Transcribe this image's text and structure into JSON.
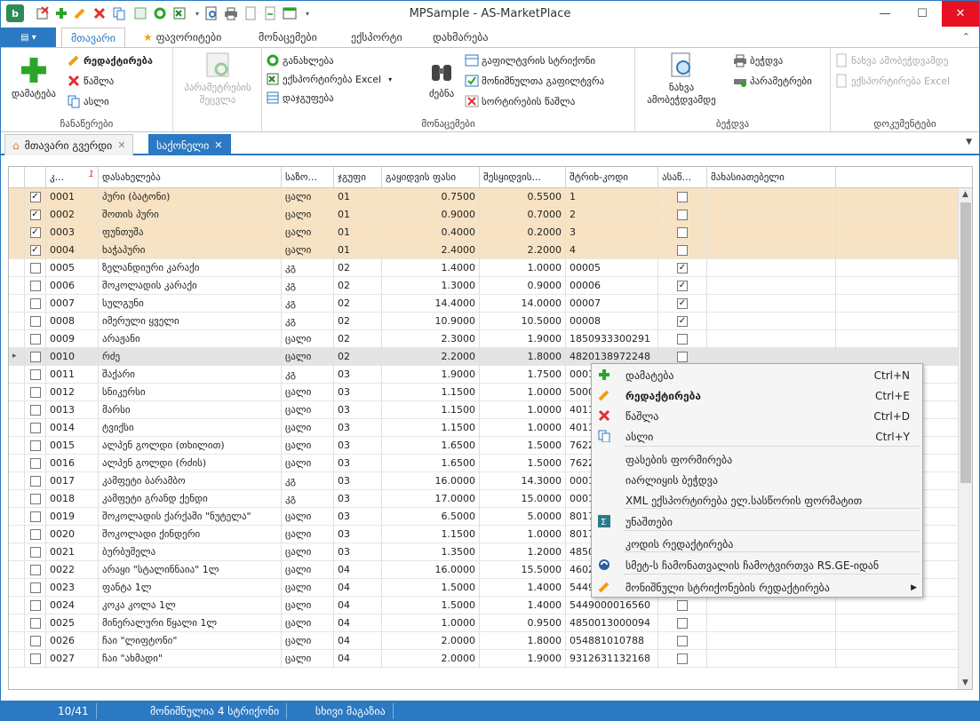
{
  "window": {
    "title": "MPSample - AS-MarketPlace"
  },
  "ribbon_tabs": [
    "მთავარი",
    "ფავორიტები",
    "მონაცემები",
    "ექსპორტი",
    "დახმარება"
  ],
  "ribbon": {
    "group_edit": {
      "caption": "ჩანაწერები",
      "add": "დამატება",
      "edit": "რედაქტირება",
      "delete": "წაშლა",
      "copy": "ასლი"
    },
    "group_params": {
      "label": "პარამეტრების შეცვლა"
    },
    "group_data": {
      "caption": "მონაცემები",
      "refresh": "განახლება",
      "export_excel": "ექსპორტირება Excel",
      "grouping": "დაჯგუფება",
      "search": "ძებნა",
      "filter_row": "გაფილტვრის სტრიქონი",
      "marked_filter": "მონიშნულთა გაფილტვრა",
      "sort_remove": "სორტირების წაშლა"
    },
    "group_print": {
      "caption": "ბეჭდვა",
      "preview": "ნახვა ამობეჭდვამდე",
      "print": "ბეჭდვა",
      "params": "პარამეტრები"
    },
    "group_docs": {
      "caption": "დოკუმენტები",
      "preview": "ნახვა ამობეჭდვამდე",
      "export": "ექსპორტირება Excel"
    }
  },
  "doc_tabs": [
    "მთავარი გვერდი",
    "საქონელი"
  ],
  "grid": {
    "columns": [
      "კ...",
      "დასახელება",
      "საზო...",
      "ჯგუფი",
      "გაყიდვის ფასი",
      "შესყიდვის...",
      "შტრიხ-კოდი",
      "ასაწ...",
      "მახასიათებელი"
    ],
    "rows": [
      {
        "checked": true,
        "code": "0001",
        "name": "პური (ბატონი)",
        "unit": "ცალი",
        "group": "01",
        "sale": "0.7500",
        "buy": "0.5500",
        "barcode": "1",
        "flag": false,
        "state": "sel"
      },
      {
        "checked": true,
        "code": "0002",
        "name": "შოთის პური",
        "unit": "ცალი",
        "group": "01",
        "sale": "0.9000",
        "buy": "0.7000",
        "barcode": "2",
        "flag": false,
        "state": "sel"
      },
      {
        "checked": true,
        "code": "0003",
        "name": "ფუნთუშა",
        "unit": "ცალი",
        "group": "01",
        "sale": "0.4000",
        "buy": "0.2000",
        "barcode": "3",
        "flag": false,
        "state": "sel"
      },
      {
        "checked": true,
        "code": "0004",
        "name": "ხაჭაპური",
        "unit": "ცალი",
        "group": "01",
        "sale": "2.4000",
        "buy": "2.2000",
        "barcode": "4",
        "flag": false,
        "state": "sel"
      },
      {
        "checked": false,
        "code": "0005",
        "name": "ზელანდიური კარაქი",
        "unit": "კგ",
        "group": "02",
        "sale": "1.4000",
        "buy": "1.0000",
        "barcode": "00005",
        "flag": true,
        "state": ""
      },
      {
        "checked": false,
        "code": "0006",
        "name": "შოკოლადის კარაქი",
        "unit": "კგ",
        "group": "02",
        "sale": "1.3000",
        "buy": "0.9000",
        "barcode": "00006",
        "flag": true,
        "state": ""
      },
      {
        "checked": false,
        "code": "0007",
        "name": "სულგუნი",
        "unit": "კგ",
        "group": "02",
        "sale": "14.4000",
        "buy": "14.0000",
        "barcode": "00007",
        "flag": true,
        "state": ""
      },
      {
        "checked": false,
        "code": "0008",
        "name": "იმერული ყველი",
        "unit": "კგ",
        "group": "02",
        "sale": "10.9000",
        "buy": "10.5000",
        "barcode": "00008",
        "flag": true,
        "state": ""
      },
      {
        "checked": false,
        "code": "0009",
        "name": "არაჟანი",
        "unit": "ცალი",
        "group": "02",
        "sale": "2.3000",
        "buy": "1.9000",
        "barcode": "1850933300291",
        "flag": false,
        "state": ""
      },
      {
        "checked": false,
        "code": "0010",
        "name": "რძე",
        "unit": "ცალი",
        "group": "02",
        "sale": "2.2000",
        "buy": "1.8000",
        "barcode": "4820138972248",
        "flag": false,
        "state": "cur"
      },
      {
        "checked": false,
        "code": "0011",
        "name": "შაქარი",
        "unit": "კგ",
        "group": "03",
        "sale": "1.9000",
        "buy": "1.7500",
        "barcode": "0001",
        "flag": false,
        "state": ""
      },
      {
        "checked": false,
        "code": "0012",
        "name": "სნიკერსი",
        "unit": "ცალი",
        "group": "03",
        "sale": "1.1500",
        "buy": "1.0000",
        "barcode": "5000",
        "flag": false,
        "state": ""
      },
      {
        "checked": false,
        "code": "0013",
        "name": "მარსი",
        "unit": "ცალი",
        "group": "03",
        "sale": "1.1500",
        "buy": "1.0000",
        "barcode": "4011",
        "flag": false,
        "state": ""
      },
      {
        "checked": false,
        "code": "0014",
        "name": "ტვიქსი",
        "unit": "ცალი",
        "group": "03",
        "sale": "1.1500",
        "buy": "1.0000",
        "barcode": "4011",
        "flag": false,
        "state": ""
      },
      {
        "checked": false,
        "code": "0015",
        "name": "ალპენ გოლდი (თხილით)",
        "unit": "ცალი",
        "group": "03",
        "sale": "1.6500",
        "buy": "1.5000",
        "barcode": "7622",
        "flag": false,
        "state": ""
      },
      {
        "checked": false,
        "code": "0016",
        "name": "ალპენ გოლდი (რძის)",
        "unit": "ცალი",
        "group": "03",
        "sale": "1.6500",
        "buy": "1.5000",
        "barcode": "7622",
        "flag": false,
        "state": ""
      },
      {
        "checked": false,
        "code": "0017",
        "name": "კამფეტი ბარამბო",
        "unit": "კგ",
        "group": "03",
        "sale": "16.0000",
        "buy": "14.3000",
        "barcode": "0001",
        "flag": false,
        "state": ""
      },
      {
        "checked": false,
        "code": "0018",
        "name": "კამფეტი გრანდ ქენდი",
        "unit": "კგ",
        "group": "03",
        "sale": "17.0000",
        "buy": "15.0000",
        "barcode": "0001",
        "flag": false,
        "state": ""
      },
      {
        "checked": false,
        "code": "0019",
        "name": "შოკოლადის ქარქაში \"ნუტელა\"",
        "unit": "ცალი",
        "group": "03",
        "sale": "6.5000",
        "buy": "5.0000",
        "barcode": "8017",
        "flag": false,
        "state": ""
      },
      {
        "checked": false,
        "code": "0020",
        "name": "შოკოლადი ქინდერი",
        "unit": "ცალი",
        "group": "03",
        "sale": "1.1500",
        "buy": "1.0000",
        "barcode": "8017",
        "flag": false,
        "state": ""
      },
      {
        "checked": false,
        "code": "0021",
        "name": "ბურბუშელა",
        "unit": "ცალი",
        "group": "03",
        "sale": "1.3500",
        "buy": "1.2000",
        "barcode": "4850",
        "flag": false,
        "state": ""
      },
      {
        "checked": false,
        "code": "0022",
        "name": "არაყი \"სტალინნაია\" 1ლ",
        "unit": "ცალი",
        "group": "04",
        "sale": "16.0000",
        "buy": "15.5000",
        "barcode": "4602",
        "flag": false,
        "state": ""
      },
      {
        "checked": false,
        "code": "0023",
        "name": "ფანტა 1ლ",
        "unit": "ცალი",
        "group": "04",
        "sale": "1.5000",
        "buy": "1.4000",
        "barcode": "5449",
        "flag": false,
        "state": ""
      },
      {
        "checked": false,
        "code": "0024",
        "name": "კოკა კოლა 1ლ",
        "unit": "ცალი",
        "group": "04",
        "sale": "1.5000",
        "buy": "1.4000",
        "barcode": "5449000016560",
        "flag": false,
        "state": ""
      },
      {
        "checked": false,
        "code": "0025",
        "name": "მინერალური წყალი 1ლ",
        "unit": "ცალი",
        "group": "04",
        "sale": "1.0000",
        "buy": "0.9500",
        "barcode": "4850013000094",
        "flag": false,
        "state": ""
      },
      {
        "checked": false,
        "code": "0026",
        "name": "ჩაი \"ლიფტონი\"",
        "unit": "ცალი",
        "group": "04",
        "sale": "2.0000",
        "buy": "1.8000",
        "barcode": "054881010788",
        "flag": false,
        "state": ""
      },
      {
        "checked": false,
        "code": "0027",
        "name": "ჩაი \"ახმადი\"",
        "unit": "ცალი",
        "group": "04",
        "sale": "2.0000",
        "buy": "1.9000",
        "barcode": "9312631132168",
        "flag": false,
        "state": ""
      }
    ]
  },
  "context_menu": [
    {
      "label": "დამატება",
      "shortcut": "Ctrl+N",
      "icon": "plus-icon",
      "bold": false
    },
    {
      "label": "რედაქტირება",
      "shortcut": "Ctrl+E",
      "icon": "pencil-icon",
      "bold": true
    },
    {
      "label": "წაშლა",
      "shortcut": "Ctrl+D",
      "icon": "delete-x-icon",
      "bold": false
    },
    {
      "label": "ასლი",
      "shortcut": "Ctrl+Y",
      "icon": "copy-icon",
      "bold": false
    },
    {
      "label": "ფასების ფორმირება",
      "shortcut": "",
      "icon": "",
      "bold": false
    },
    {
      "label": "იარლიყის ბეჭდვა",
      "shortcut": "",
      "icon": "",
      "bold": false
    },
    {
      "label": "XML ექსპორტირება ელ.სასწორის ფორმატით",
      "shortcut": "",
      "icon": "",
      "bold": false
    },
    {
      "label": "უნაშთები",
      "shortcut": "",
      "icon": "sigma-icon",
      "bold": false
    },
    {
      "label": "კოდის რედაქტირება",
      "shortcut": "",
      "icon": "",
      "bold": false
    },
    {
      "label": "სმეტ-ს ჩამონათვალის ჩამოტვირთვა RS.GE-იდან",
      "shortcut": "",
      "icon": "rs-sync-icon",
      "bold": false
    },
    {
      "label": "მონიშნული სტრიქონების რედაქტირება",
      "shortcut": "",
      "icon": "pencil-icon",
      "bold": false,
      "submenu": true
    }
  ],
  "status": {
    "position": "10/41",
    "marked": "მონიშნულია 4 სტრიქონი",
    "list": "სხივი მაგაზია"
  },
  "colors": {
    "accent": "#2b79c2",
    "selected_row": "#f7e3c3",
    "current_row": "#e4e4e4",
    "close_red": "#e81123"
  }
}
